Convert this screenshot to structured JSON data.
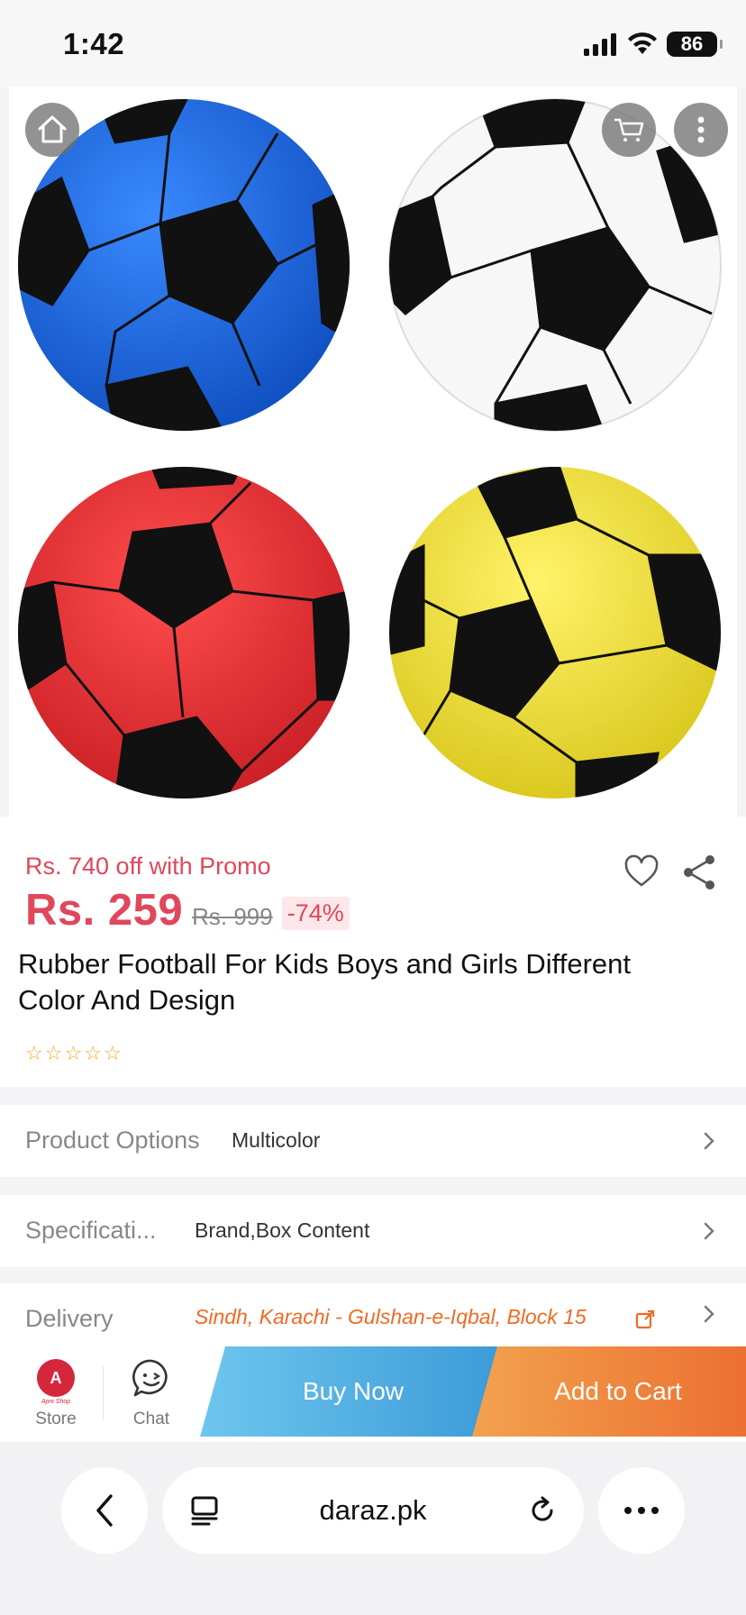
{
  "status_bar": {
    "time": "1:42",
    "battery": "86"
  },
  "product": {
    "promo_text": "Rs. 740 off with Promo",
    "price": "Rs. 259",
    "original_price": "Rs. 999",
    "discount": "-74%",
    "title": "Rubber Football For Kids Boys and Girls Different Color And Design",
    "rating_stars": 0,
    "ball_colors": [
      "#1f6fe0",
      "#ffffff",
      "#e8353a",
      "#f3e43a"
    ]
  },
  "details": {
    "product_options": {
      "label": "Product Options",
      "value": "Multicolor"
    },
    "specifications": {
      "label": "Specificati...",
      "value": "Brand,Box Content"
    },
    "delivery": {
      "label": "Delivery",
      "value": "Sindh, Karachi - Gulshan-e-Iqbal, Block 15"
    }
  },
  "actions": {
    "store_label": "Store",
    "store_logo_letter": "A",
    "store_logo_name": "Apni Shop",
    "chat_label": "Chat",
    "buy_now": "Buy Now",
    "add_to_cart": "Add to Cart"
  },
  "browser": {
    "url": "daraz.pk"
  },
  "colors": {
    "accent": "#e0475b",
    "delivery": "#f06a24"
  }
}
